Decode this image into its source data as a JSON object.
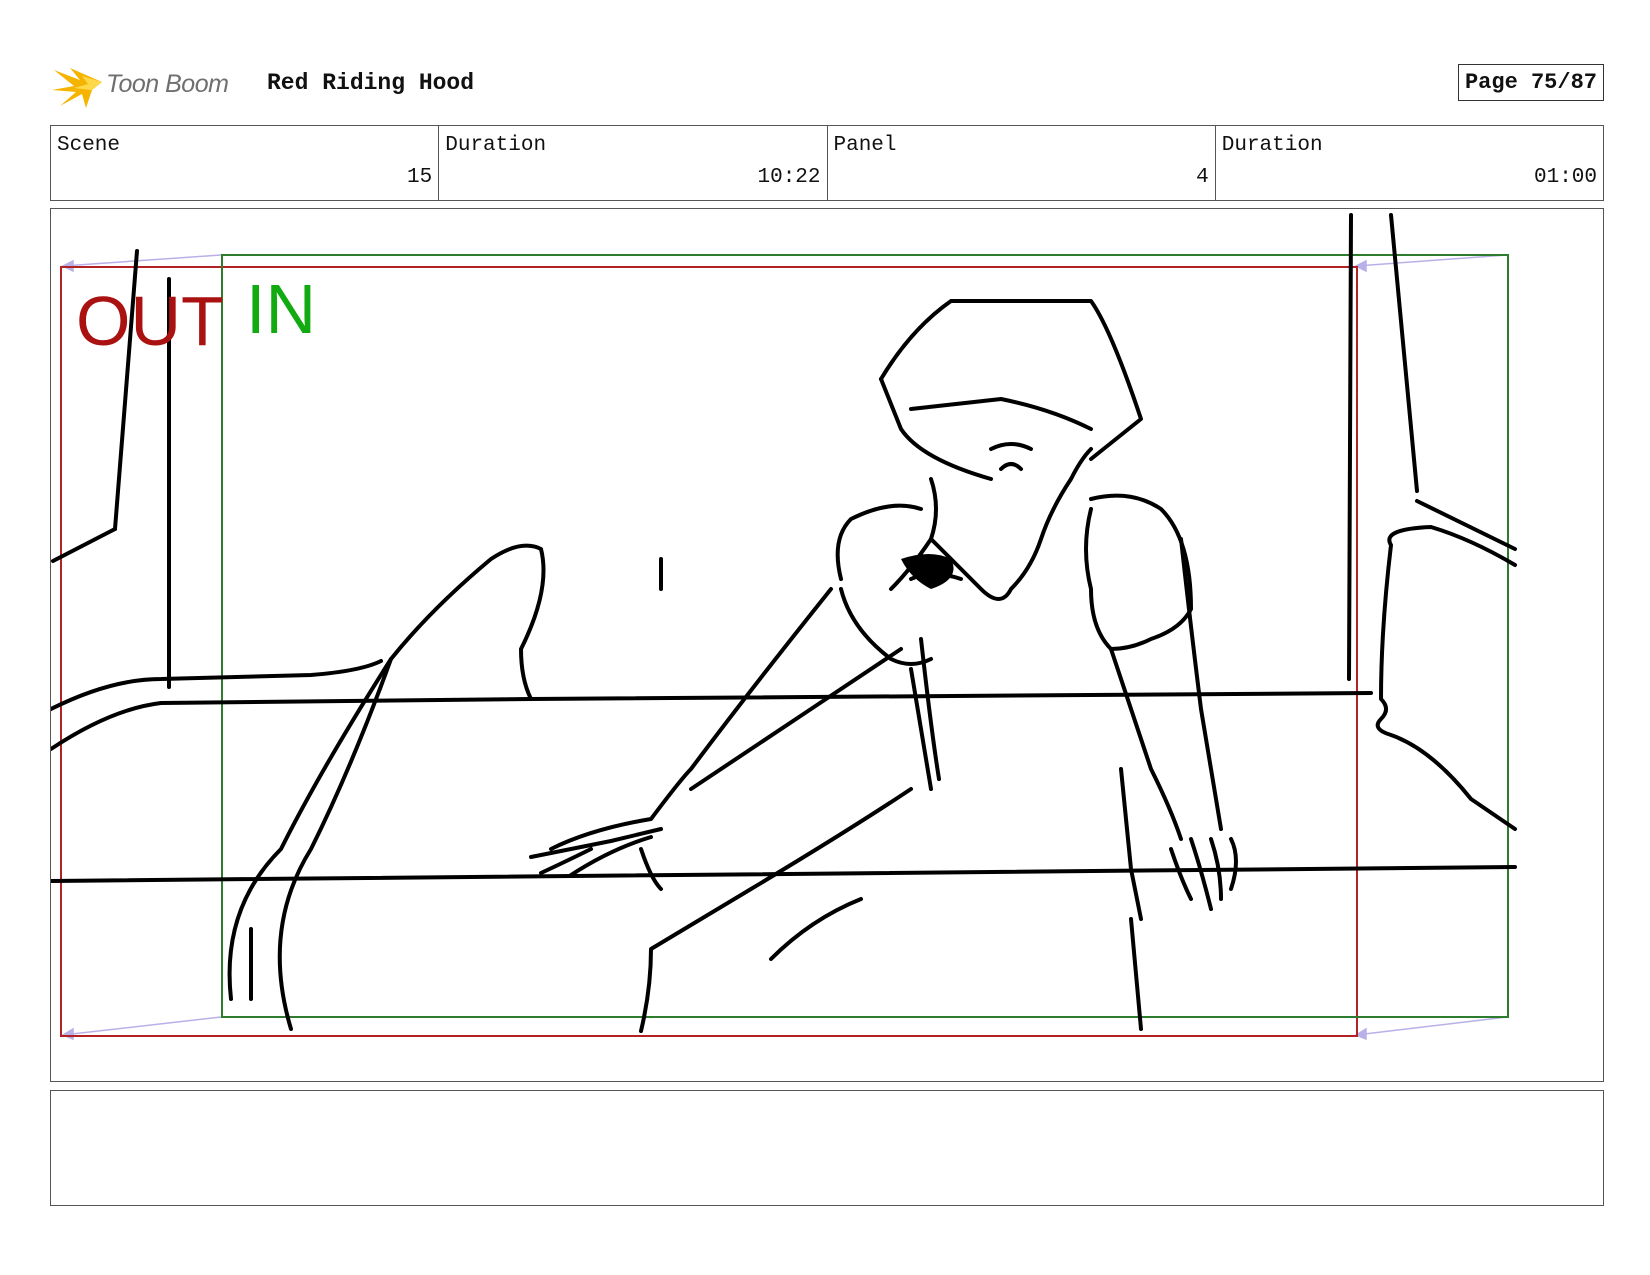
{
  "header": {
    "logo_text": "Toon Boom",
    "project_title": "Red Riding Hood",
    "page_label": "Page 75/87"
  },
  "info": [
    {
      "label": "Scene",
      "value": "15"
    },
    {
      "label": "Duration",
      "value": "10:22"
    },
    {
      "label": "Panel",
      "value": "4"
    },
    {
      "label": "Duration",
      "value": "01:00"
    }
  ],
  "panel": {
    "out_label": "OUT",
    "in_label": "IN",
    "colors": {
      "out_frame": "#b22222",
      "in_frame": "#2e7d2e",
      "camera_guides": "#b8b0e8",
      "sketch": "#000000"
    }
  },
  "notes": {
    "text": ""
  }
}
